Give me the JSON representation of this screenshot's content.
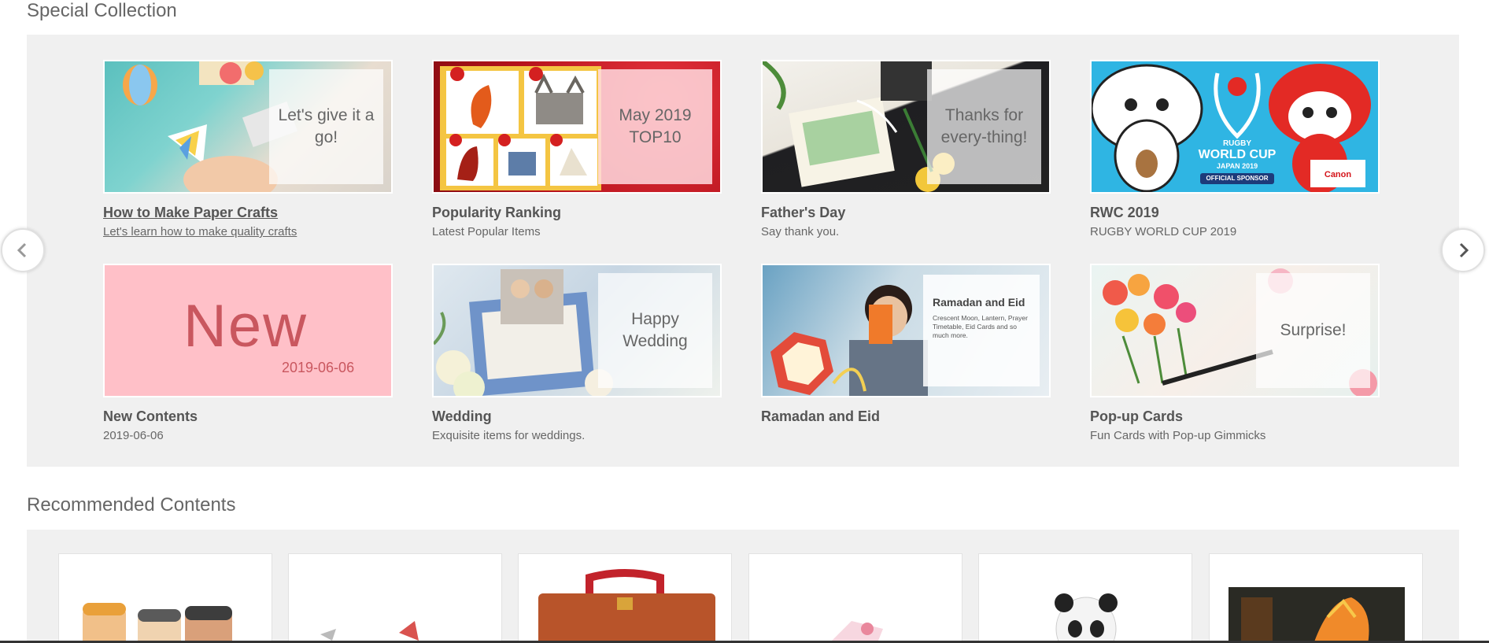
{
  "special_collection": {
    "title": "Special Collection",
    "items": [
      {
        "title": "How to Make Paper Crafts",
        "subtitle": "Let's learn how to make quality crafts",
        "overlay": "Let's give it a go!"
      },
      {
        "title": "Popularity Ranking",
        "subtitle": "Latest Popular Items",
        "overlay": "May 2019 TOP10"
      },
      {
        "title": "Father's Day",
        "subtitle": "Say thank you.",
        "overlay": "Thanks for every-thing!"
      },
      {
        "title": "RWC 2019",
        "subtitle": "RUGBY WORLD CUP 2019",
        "banner": {
          "line1": "RUGBY",
          "line2": "WORLD CUP",
          "line3": "JAPAN 2019",
          "line4": "OFFICIAL SPONSOR",
          "brand": "Canon"
        }
      },
      {
        "title": "New Contents",
        "subtitle": "2019-06-06",
        "banner": {
          "big": "New",
          "date": "2019-06-06"
        }
      },
      {
        "title": "Wedding",
        "subtitle": "Exquisite items for weddings.",
        "overlay": "Happy Wedding"
      },
      {
        "title": "Ramadan and Eid",
        "subtitle": "",
        "banner": {
          "heading": "Ramadan and Eid",
          "text": "Crescent Moon, Lantern, Prayer Timetable, Eid Cards and so much more."
        }
      },
      {
        "title": "Pop-up Cards",
        "subtitle": "Fun Cards with Pop-up Gimmicks",
        "overlay": "Surprise!"
      }
    ]
  },
  "recommended": {
    "title": "Recommended Contents"
  },
  "colors": {
    "panel_bg": "#f0f0f0",
    "new_banner_pink": "#ffc0c8",
    "new_text": "#c9575f",
    "rwc_blue": "#2fb5e3",
    "ranking_red": "#b5121b"
  }
}
